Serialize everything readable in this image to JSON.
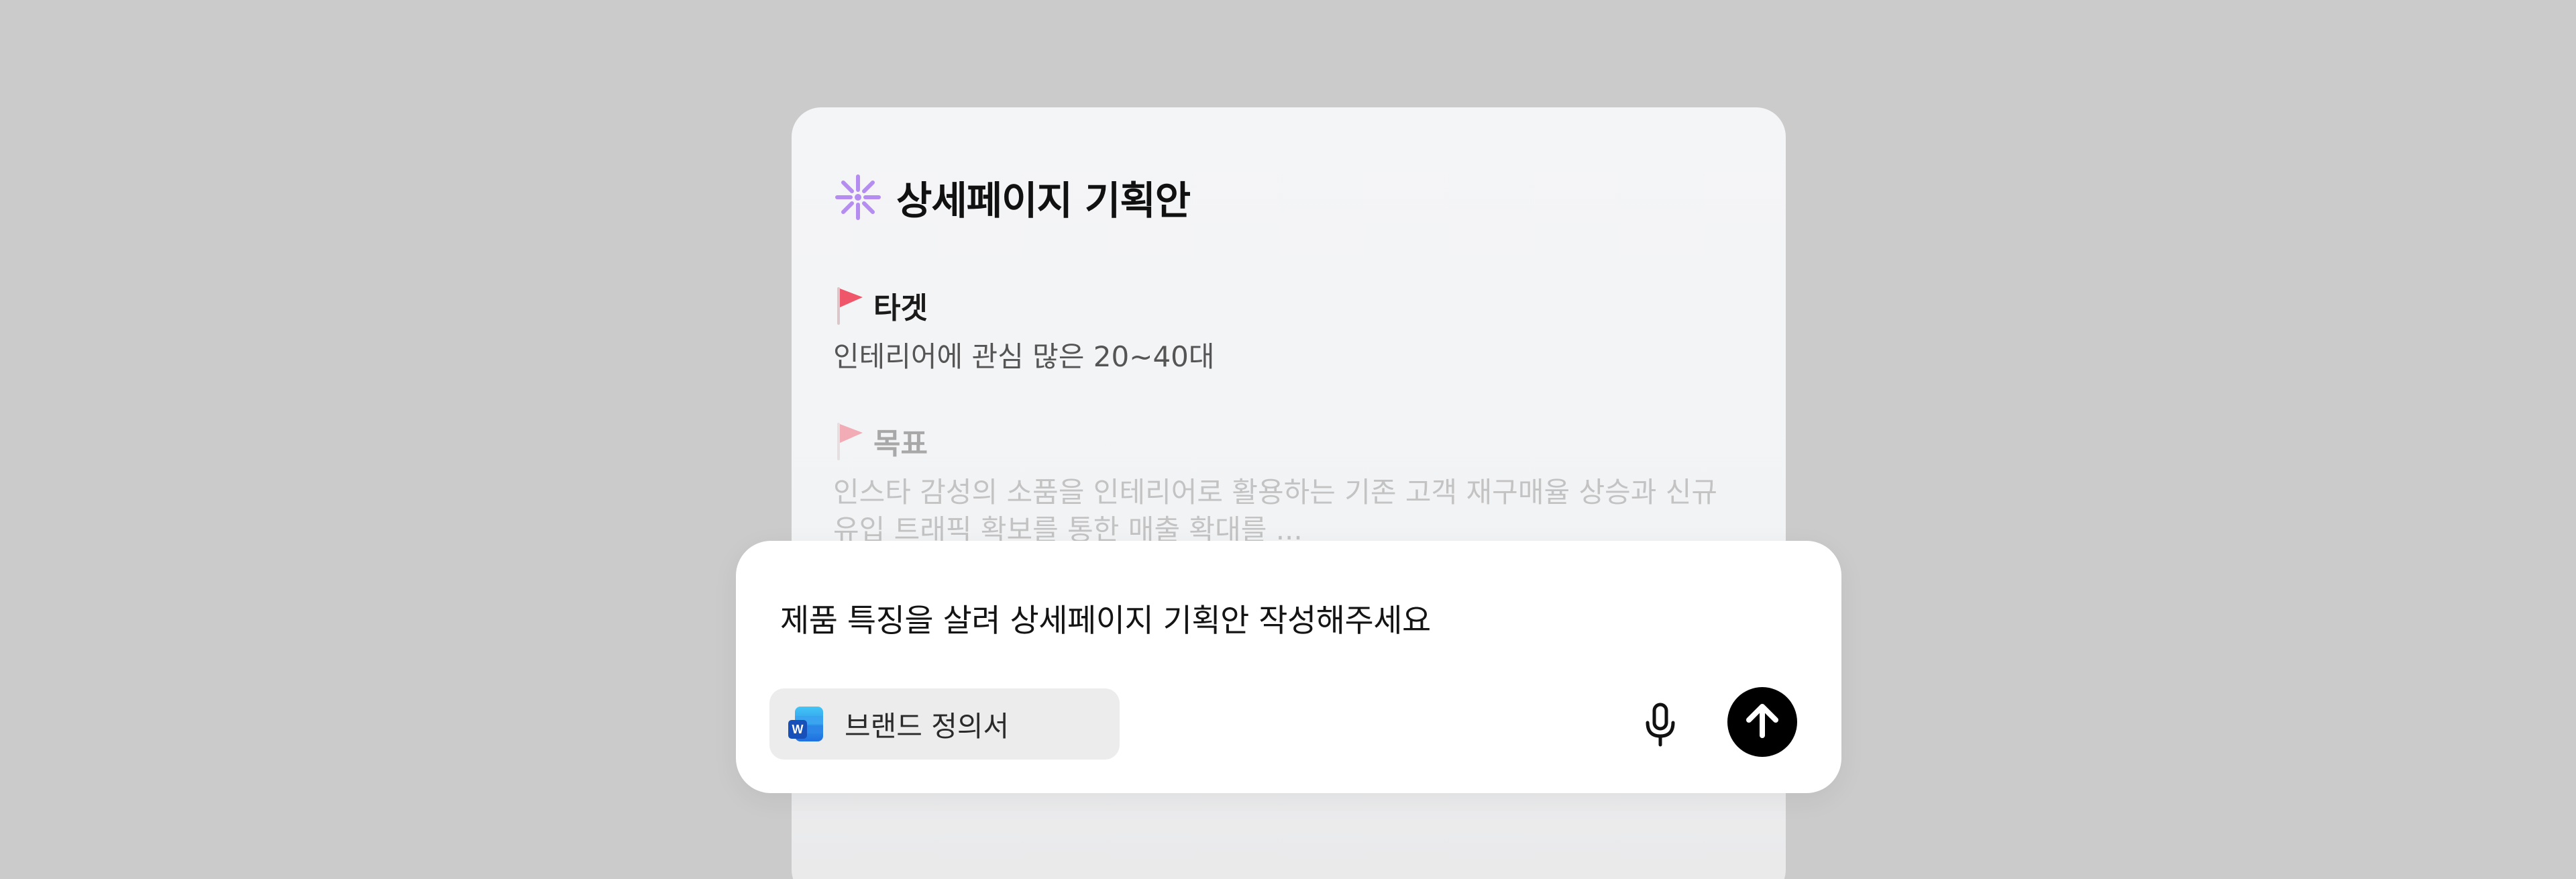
{
  "document": {
    "title": "상세페이지 기획안",
    "title_icon": "sparkle-icon",
    "sections": [
      {
        "label": "타겟",
        "icon": "flag-icon",
        "body": "인테리어에 관심 많은 20~40대"
      },
      {
        "label": "목표",
        "icon": "flag-icon",
        "body": "인스타 감성의 소품을 인테리어로 활용하는 기존 고객 재구매율 상승과 신규 유입 트래픽 확보를 통한 매출 확대를 ..."
      }
    ]
  },
  "composer": {
    "prompt": "제품 특징을 살려 상세페이지 기획안 작성해주세요",
    "attachment": {
      "label": "브랜드 정의서",
      "icon": "word-document-icon"
    },
    "mic_icon": "microphone-icon",
    "send_icon": "arrow-up-icon"
  },
  "colors": {
    "background": "#cbcbcb",
    "sparkle": "#b58cf0",
    "flag": "#f0566a",
    "send_button": "#000000"
  }
}
